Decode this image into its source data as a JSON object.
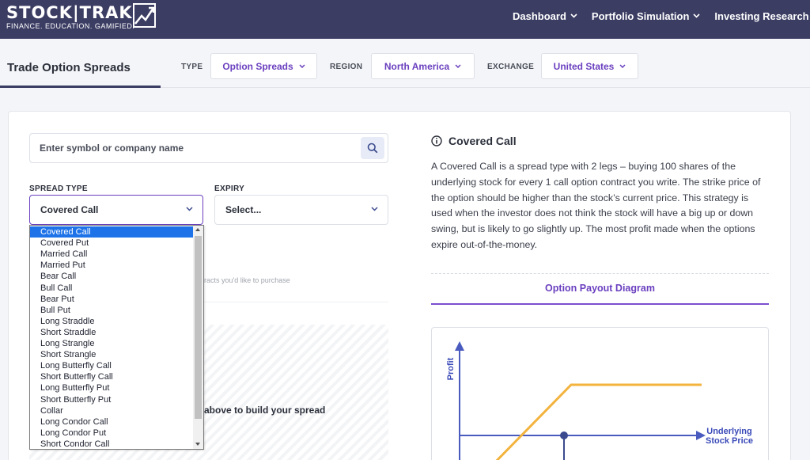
{
  "brand": {
    "name": "STOCK|TRAK",
    "tagline": "FINANCE. EDUCATION. GAMIFIED."
  },
  "nav": {
    "items": [
      {
        "label": "Dashboard"
      },
      {
        "label": "Portfolio Simulation"
      },
      {
        "label": "Investing Research"
      }
    ]
  },
  "subheader": {
    "page_title": "Trade Option Spreads",
    "filters": {
      "type": {
        "label": "TYPE",
        "value": "Option Spreads"
      },
      "region": {
        "label": "REGION",
        "value": "North America"
      },
      "exchange": {
        "label": "EXCHANGE",
        "value": "United States"
      }
    }
  },
  "form": {
    "search_placeholder": "Enter symbol or company name",
    "spread_type": {
      "label": "SPREAD TYPE",
      "value": "Covered Call",
      "options": [
        "Covered Call",
        "Covered Put",
        "Married Call",
        "Married Put",
        "Bear Call",
        "Bull Call",
        "Bear Put",
        "Bull Put",
        "Long Straddle",
        "Short Straddle",
        "Long Strangle",
        "Short Strangle",
        "Long Butterfly Call",
        "Short Butterfly Call",
        "Long Butterfly Put",
        "Short Butterfly Put",
        "Collar",
        "Long Condor Call",
        "Long Condor Put",
        "Short Condor Call"
      ],
      "selected_index": 0
    },
    "expiry": {
      "label": "EXPIRY",
      "value": "Select..."
    },
    "hint_fragment": "racts you'd like to purchase",
    "build_fragment": "above to build your spread"
  },
  "info": {
    "title": "Covered Call",
    "description": "A Covered Call is a spread type with 2 legs – buying 100 shares of the underlying stock for every 1 call option contract you write. The strike price of the option should be higher than the stock’s current price. This strategy is used when the investor does not think the stock will have a big up or down swing, but is likely to go slightly up. The most profit made when the options expire out-of-the-money.",
    "diagram_tab": "Option Payout Diagram",
    "diagram": {
      "y_label": "Profit",
      "x_label_line1": "Underlying",
      "x_label_line2": "Stock Price"
    }
  },
  "colors": {
    "nav_bg": "#3b3d63",
    "accent_purple": "#6a3fbf",
    "select_highlight": "#1e73e8",
    "payout_line": "#f3b33d",
    "axis_color": "#4a5bbf"
  }
}
